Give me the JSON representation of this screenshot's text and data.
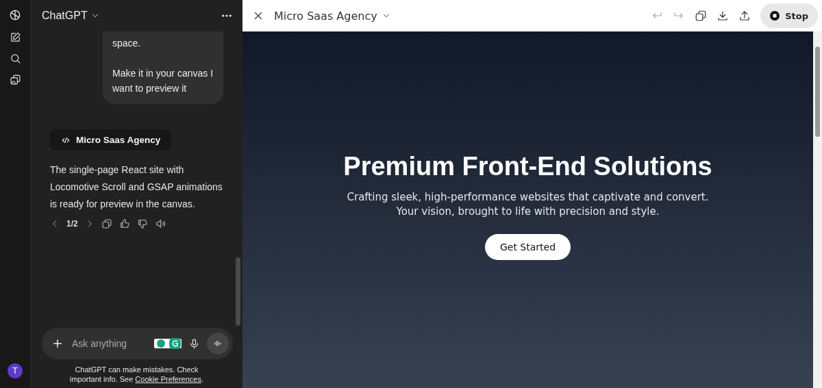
{
  "sidebar": {
    "avatar": "T"
  },
  "chat": {
    "title": "ChatGPT",
    "user_message": [
      "space.",
      "Make it in your canvas I want to preview it"
    ],
    "canvas_chip": "Micro Saas Agency",
    "reply": "The single-page React site with Locomotive Scroll and GSAP animations is ready for preview in the canvas.",
    "pager": "1/2",
    "composer": {
      "placeholder": "Ask anything"
    },
    "disclaimer": "ChatGPT can make mistakes. Check important info. See ",
    "disclaimer_link": "Cookie Preferences",
    "disclaimer_end": "."
  },
  "canvas": {
    "title": "Micro Saas Agency",
    "stop_button": "Stop",
    "preview": {
      "heading": "Premium Front-End Solutions",
      "subtitle": [
        "Crafting sleek, high-performance websites that captivate and convert.",
        "Your vision, brought to life with precision and style."
      ],
      "cta": "Get Started"
    }
  }
}
